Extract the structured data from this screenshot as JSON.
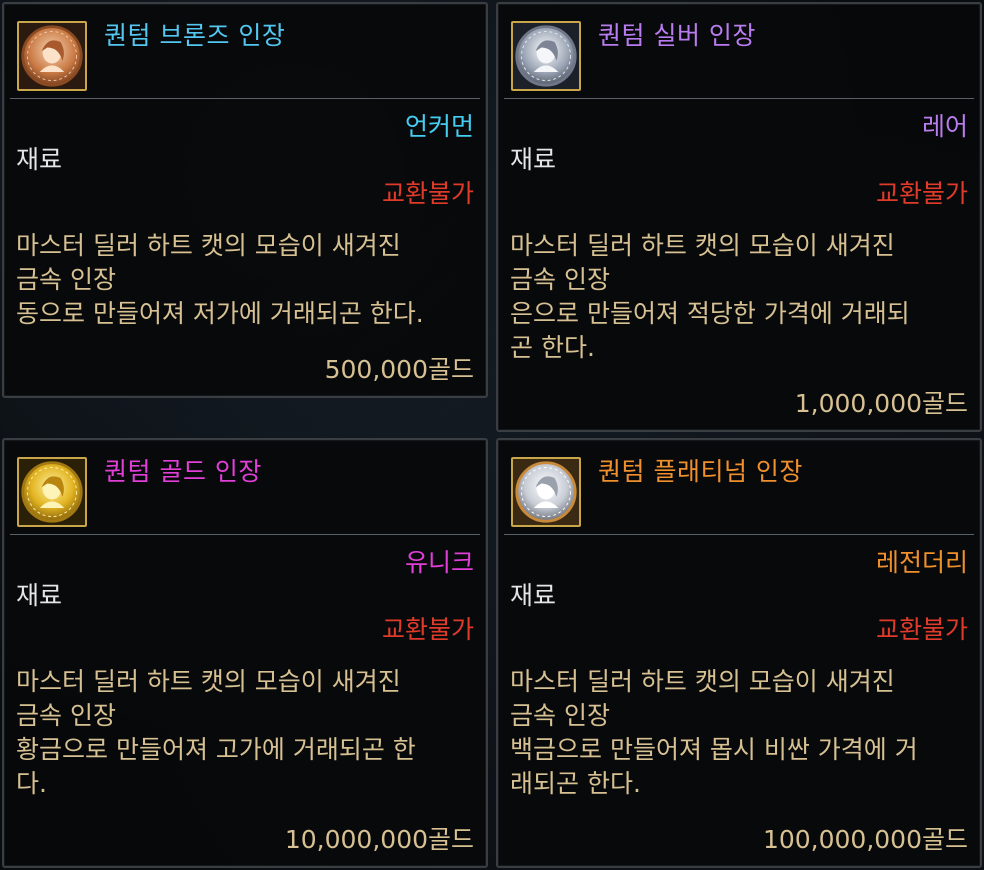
{
  "cards": [
    {
      "name": "퀀텀 브론즈 인장",
      "name_color": "#53c7f0",
      "rarity": "언커먼",
      "rarity_color": "#45cdf2",
      "category": "재료",
      "trade": "교환불가",
      "desc": [
        "마스터 딜러 하트 캣의 모습이 새겨진",
        "금속 인장",
        "동으로 만들어져 저가에 거래되곤 한다."
      ],
      "price": "500,000골드",
      "icon": "bronze-seal-icon"
    },
    {
      "name": "퀀텀 실버 인장",
      "name_color": "#b97cf0",
      "rarity": "레어",
      "rarity_color": "#b97cf0",
      "category": "재료",
      "trade": "교환불가",
      "desc": [
        "마스터 딜러 하트 캣의 모습이 새겨진",
        "금속 인장",
        "은으로 만들어져 적당한 가격에 거래되",
        "곤 한다."
      ],
      "price": "1,000,000골드",
      "icon": "silver-seal-icon"
    },
    {
      "name": "퀀텀 골드 인장",
      "name_color": "#e23fd9",
      "rarity": "유니크",
      "rarity_color": "#e23fd9",
      "category": "재료",
      "trade": "교환불가",
      "desc": [
        "마스터 딜러 하트 캣의 모습이 새겨진",
        "금속 인장",
        "황금으로 만들어져 고가에 거래되곤 한",
        "다."
      ],
      "price": "10,000,000골드",
      "icon": "gold-seal-icon"
    },
    {
      "name": "퀀텀 플래티넘 인장",
      "name_color": "#f0902c",
      "rarity": "레전더리",
      "rarity_color": "#f0902c",
      "category": "재료",
      "trade": "교환불가",
      "desc": [
        "마스터 딜러 하트 캣의 모습이 새겨진",
        "금속 인장",
        "백금으로 만들어져 몹시 비싼 가격에 거",
        "래되곤 한다."
      ],
      "price": "100,000,000골드",
      "icon": "platinum-seal-icon"
    }
  ]
}
